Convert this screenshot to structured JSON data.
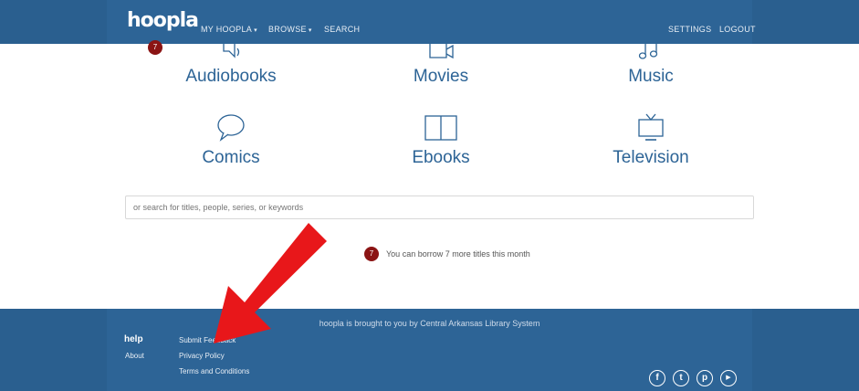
{
  "header": {
    "logo": "hoopla",
    "badge_count": "7",
    "nav_left": [
      {
        "label": "MY HOOPLA",
        "caret": "▾"
      },
      {
        "label": "BROWSE",
        "caret": "▾"
      },
      {
        "label": "SEARCH",
        "caret": ""
      }
    ],
    "nav_right": [
      {
        "label": "SETTINGS"
      },
      {
        "label": "LOGOUT"
      }
    ]
  },
  "categories": [
    {
      "label": "Audiobooks",
      "icon": "speaker-icon"
    },
    {
      "label": "Movies",
      "icon": "video-camera-icon"
    },
    {
      "label": "Music",
      "icon": "music-note-icon"
    },
    {
      "label": "Comics",
      "icon": "speech-bubble-icon"
    },
    {
      "label": "Ebooks",
      "icon": "book-icon"
    },
    {
      "label": "Television",
      "icon": "tv-icon"
    }
  ],
  "search": {
    "placeholder": "or search for titles, people, series, or keywords"
  },
  "borrow": {
    "badge": "7",
    "text": "You can borrow 7 more titles this month"
  },
  "footer": {
    "brought_by": "hoopla is brought to you by Central Arkansas Library System",
    "help_label": "help",
    "about_label": "About",
    "links": [
      "Submit Feedback",
      "Privacy Policy",
      "Terms and Conditions"
    ],
    "social": [
      {
        "name": "facebook-icon",
        "glyph": "f"
      },
      {
        "name": "twitter-icon",
        "glyph": "t"
      },
      {
        "name": "pinterest-icon",
        "glyph": "p"
      },
      {
        "name": "youtube-icon",
        "glyph": "▶"
      }
    ]
  },
  "colors": {
    "nav_blue": "#2d6496",
    "badge_red": "#8b1414",
    "arrow_red": "#e8171a"
  }
}
